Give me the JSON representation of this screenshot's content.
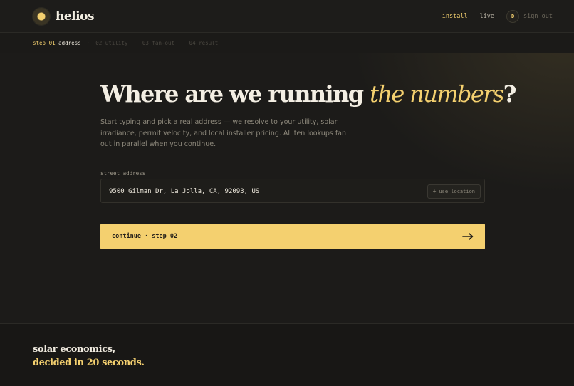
{
  "brand": {
    "name": "helios"
  },
  "nav": {
    "install": "install",
    "live": "live",
    "avatar_initial": "D",
    "sign_out": "sign out"
  },
  "steps": [
    {
      "num": "step 01",
      "label": "address",
      "current": true
    },
    {
      "num": "02",
      "label": "utility",
      "current": false
    },
    {
      "num": "03",
      "label": "fan-out",
      "current": false
    },
    {
      "num": "04",
      "label": "result",
      "current": false
    }
  ],
  "step_separator": "·",
  "main": {
    "headline_lead": "Where are we running ",
    "headline_accent": "the numbers",
    "headline_tail": "?",
    "subtitle": "Start typing and pick a real address — we resolve to your utility, solar irradiance, permit velocity, and local installer pricing. All ten lookups fan out in parallel when you continue.",
    "address_label": "street address",
    "address_value": "9500 Gilman Dr, La Jolla, CA, 92093, US",
    "use_location_label": "use location",
    "continue_label": "continue · step 02"
  },
  "footer": {
    "line1": "solar economics,",
    "line2": "decided in 20 seconds."
  },
  "colors": {
    "background": "#1c1b19",
    "accent": "#f4d06f",
    "text": "#e9e4d8",
    "muted": "#8e897c"
  }
}
